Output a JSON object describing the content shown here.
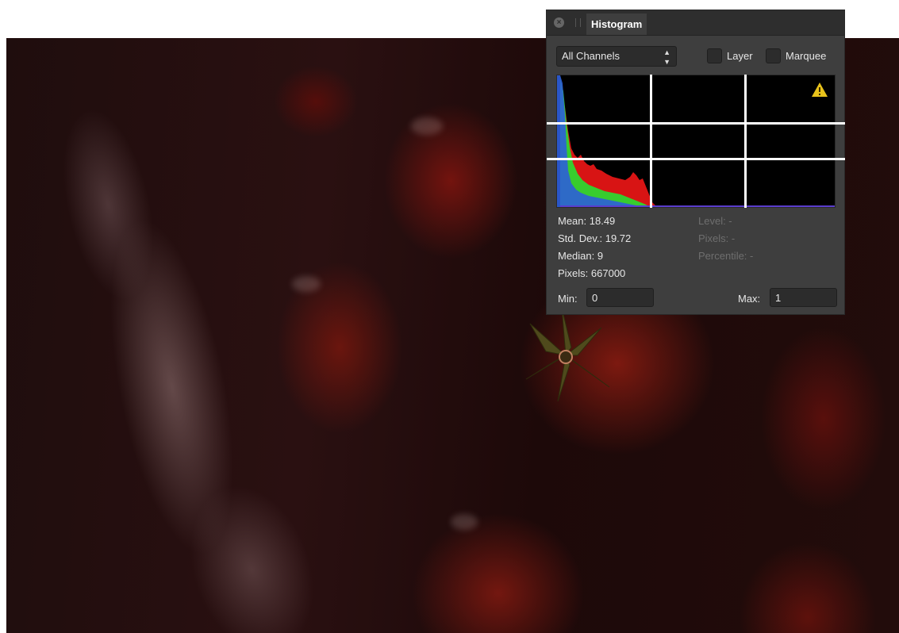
{
  "panel": {
    "tab_label": "Histogram",
    "channel_select": {
      "value": "All Channels",
      "stepper_glyph": "⌃⌄"
    },
    "layer_checkbox_label": "Layer",
    "marquee_checkbox_label": "Marquee",
    "stats": {
      "mean": "Mean: 18.49",
      "std_dev": "Std. Dev.: 19.72",
      "median": "Median: 9",
      "pixels": "Pixels: 667000",
      "level": "Level: -",
      "cursor_pixels": "Pixels: -",
      "percentile": "Percentile: -"
    },
    "min_label": "Min:",
    "min_value": "0",
    "max_label": "Max:",
    "max_value": "1"
  },
  "colors": {
    "panel_bg": "#3e3e3e",
    "red_channel": "#e01010",
    "green_channel": "#2fd62f",
    "blue_channel": "#2e5fd8",
    "warning": "#e8c21b"
  },
  "icons": {
    "close": "close-icon",
    "warning": "warning-icon",
    "grip": "grip-icon"
  }
}
